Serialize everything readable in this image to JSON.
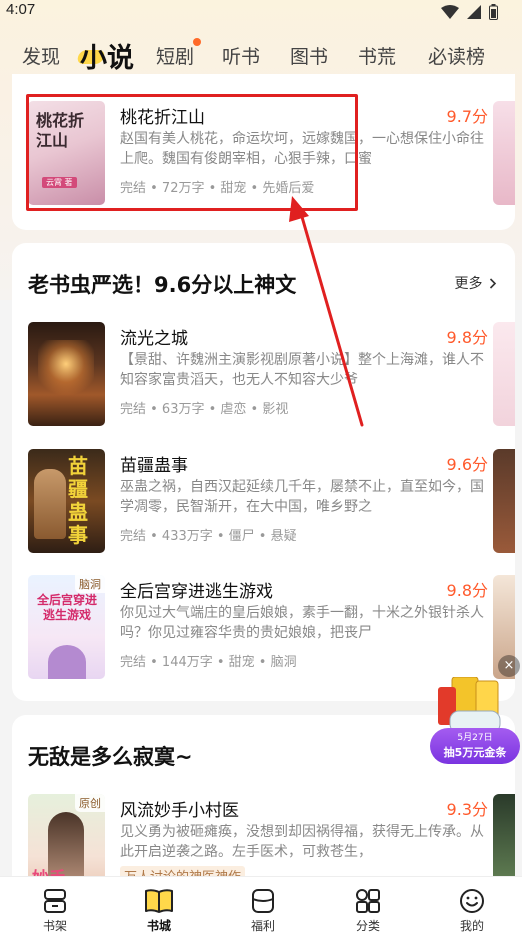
{
  "status_bar": {
    "time": "4:07"
  },
  "category_tabs": [
    {
      "label": "发现",
      "active": false
    },
    {
      "label": "小说",
      "active": true
    },
    {
      "label": "短剧",
      "active": false,
      "badge_dot": true
    },
    {
      "label": "听书",
      "active": false
    },
    {
      "label": "图书",
      "active": false
    },
    {
      "label": "书荒",
      "active": false
    },
    {
      "label": "必读榜",
      "active": false
    }
  ],
  "top_card": {
    "book": {
      "title": "桃花折江山",
      "score": "9.7分",
      "desc": "赵国有美人桃花，命运坎坷，远嫁魏国，一心想保住小命往上爬。魏国有俊朗宰相，心狠手辣，口蜜",
      "meta": "完结 • 72万字 • 甜宠 • 先婚后爱",
      "cover_text": "桃花折江山",
      "cover_sub": "云霄 著"
    }
  },
  "section_picks": {
    "title": "老书虫严选！9.6分以上神文",
    "more": "更多",
    "books": [
      {
        "title": "流光之城",
        "score": "9.8分",
        "desc": "【景甜、许魏洲主演影视剧原著小说】整个上海滩，谁人不知容家富贵滔天，也无人不知容大少爷",
        "meta": "完结 • 63万字 • 虐恋 • 影视"
      },
      {
        "title": "苗疆蛊事",
        "score": "9.6分",
        "desc": "巫蛊之祸，自西汉起延续几千年，屡禁不止，直至如今，国学凋零，民智渐开，在大中国，唯乡野之",
        "meta": "完结 • 433万字 • 僵尸 • 悬疑",
        "cover_text": "苗疆蛊事"
      },
      {
        "title": "全后宫穿进逃生游戏",
        "score": "9.8分",
        "desc": "你见过大气端庄的皇后娘娘，素手一翻，十米之外银针杀人吗？你见过雍容华贵的贵妃娘娘，把丧尸",
        "meta": "完结 • 144万字 • 甜宠 • 脑洞",
        "cover_tag": "脑洞",
        "cover_text": "全后宫穿进逃生游戏"
      }
    ]
  },
  "section_lonely": {
    "title": "无敌是多么寂寞~",
    "books": [
      {
        "title": "风流妙手小村医",
        "score": "9.3分",
        "desc": "见义勇为被砸瘫痪，没想到却因祸得福，获得无上传承。从此开启逆袭之路。左手医术，可救苍生，",
        "meta": "万人讨论的神医神作",
        "cover_tag": "原创",
        "cover_text": "妙手"
      }
    ]
  },
  "promo": {
    "date": "5月27日",
    "text": "抽5万元金条",
    "close": "×"
  },
  "bottom_nav": [
    {
      "label": "书架",
      "icon": "bookshelf-icon",
      "active": false
    },
    {
      "label": "书城",
      "icon": "bookstore-icon",
      "active": true
    },
    {
      "label": "福利",
      "icon": "gift-icon",
      "active": false
    },
    {
      "label": "分类",
      "icon": "category-icon",
      "active": false
    },
    {
      "label": "我的",
      "icon": "profile-icon",
      "active": false
    }
  ],
  "colors": {
    "accent": "#ff5a2c",
    "highlight": "#e02020",
    "tab_underline": "#ffd84a"
  }
}
